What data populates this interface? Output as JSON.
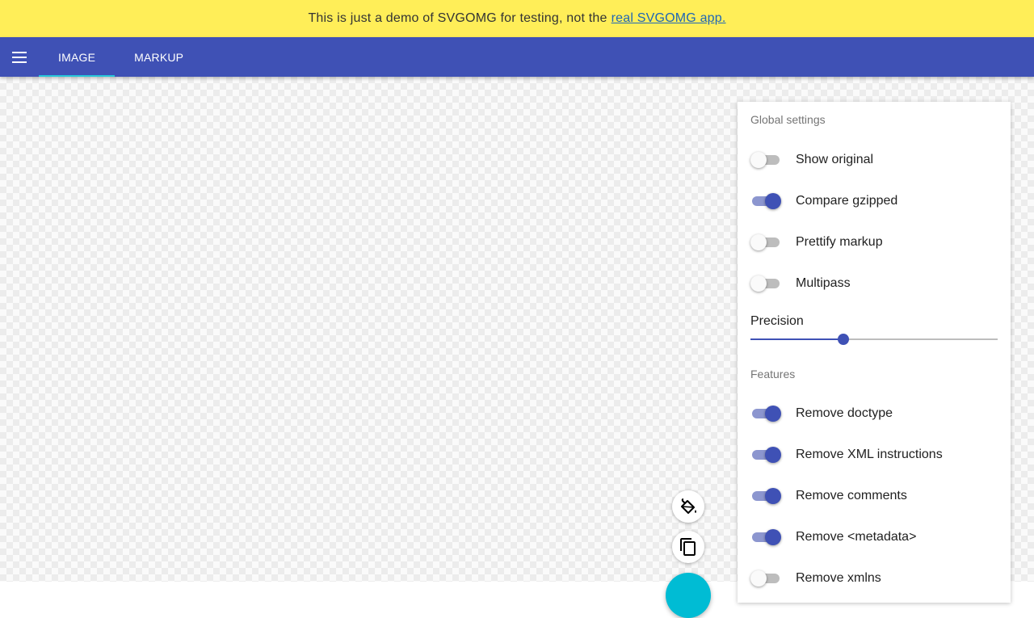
{
  "banner": {
    "text": "This is just a demo of SVGOMG for testing, not the",
    "link_text": "real SVGOMG app."
  },
  "appbar": {
    "menu_icon": "hamburger-menu-icon",
    "tabs": [
      {
        "label": "Image",
        "active": true
      },
      {
        "label": "Markup",
        "active": false
      }
    ]
  },
  "fabs": {
    "top_icon": "paint-bucket-icon",
    "middle_icon": "copy-icon"
  },
  "settings": {
    "global_title": "Global settings",
    "global": [
      {
        "label": "Show original",
        "on": false
      },
      {
        "label": "Compare gzipped",
        "on": true
      },
      {
        "label": "Prettify markup",
        "on": false
      },
      {
        "label": "Multipass",
        "on": false
      }
    ],
    "precision_label": "Precision",
    "precision_fraction": 0.376,
    "features_title": "Features",
    "features": [
      {
        "label": "Remove doctype",
        "on": true
      },
      {
        "label": "Remove XML instructions",
        "on": true
      },
      {
        "label": "Remove comments",
        "on": true
      },
      {
        "label": "Remove <metadata>",
        "on": true
      },
      {
        "label": "Remove xmlns",
        "on": false
      }
    ]
  },
  "colors": {
    "banner": "#ffee58",
    "primary": "#3f51b5",
    "accent": "#00bcd4"
  }
}
